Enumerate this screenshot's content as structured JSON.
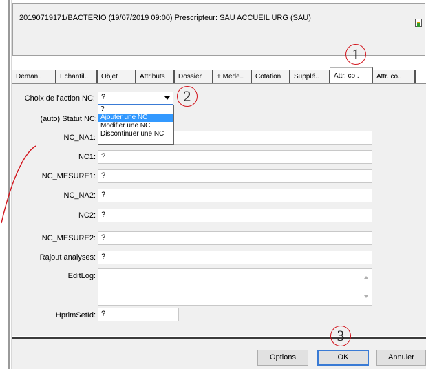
{
  "header": {
    "info": "20190719171/BACTERIO (19/07/2019 09:00) Prescripteur: SAU ACCUEIL URG (SAU)"
  },
  "tabs": [
    {
      "label": "Deman.."
    },
    {
      "label": "Echantil.."
    },
    {
      "label": "Objet"
    },
    {
      "label": "Attributs"
    },
    {
      "label": "Dossier"
    },
    {
      "label": "+ Mede.."
    },
    {
      "label": "Cotation"
    },
    {
      "label": "Supplé.."
    },
    {
      "label": "Attr. co.."
    },
    {
      "label": "Attr. co.."
    }
  ],
  "form": {
    "action_label": "Choix de l'action NC:",
    "action_value": "?",
    "statut_label": "(auto) Statut NC:",
    "na1_label": "NC_NA1:",
    "nc1_label": "NC1:",
    "nc1_value": "?",
    "mesure1_label": "NC_MESURE1:",
    "mesure1_value": "?",
    "na2_label": "NC_NA2:",
    "na2_value": "?",
    "nc2_label": "NC2:",
    "nc2_value": "?",
    "mesure2_label": "NC_MESURE2:",
    "mesure2_value": "?",
    "rajout_label": "Rajout analyses:",
    "rajout_value": "?",
    "editlog_label": "EditLog:",
    "hprim_label": "HprimSetId:",
    "hprim_value": "?"
  },
  "dropdown": {
    "options": [
      "?",
      "Ajouter une NC",
      "Modifier une NC",
      "Discontinuer une NC"
    ],
    "selected_index": 1
  },
  "buttons": {
    "options": "Options",
    "ok": "OK",
    "cancel": "Annuler"
  },
  "markers": {
    "m1": "1",
    "m2": "2",
    "m3": "3"
  },
  "colors": {
    "annotation": "#d2141c",
    "selection": "#3399ff",
    "focus": "#3a7bd5"
  }
}
